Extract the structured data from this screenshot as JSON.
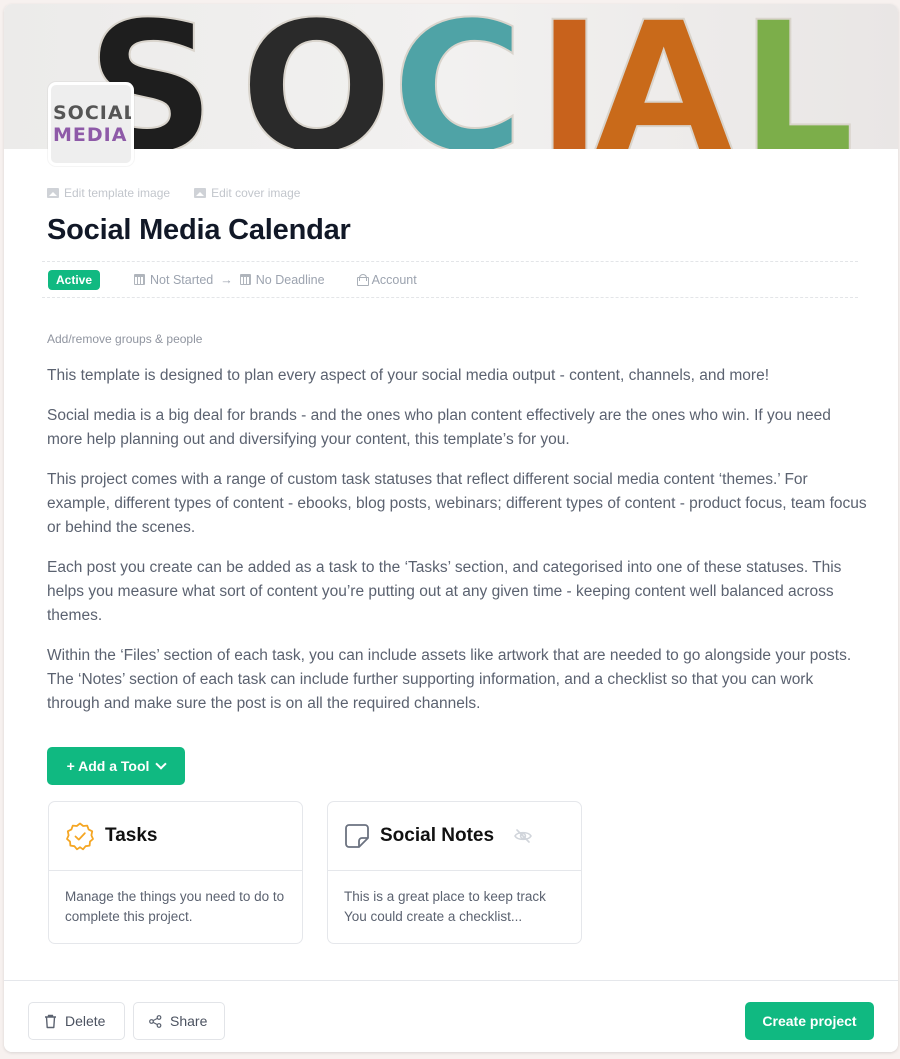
{
  "cover": {
    "letters": [
      "S",
      "O",
      "C",
      "I",
      "A",
      "L"
    ],
    "thumbnail_lines": [
      "SOCIAL",
      "MEDIA"
    ]
  },
  "edit_links": {
    "template_image": "Edit template image",
    "cover_image": "Edit cover image"
  },
  "project": {
    "title": "Social Media Calendar",
    "status": "Active",
    "start_date": "Not Started",
    "deadline": "No Deadline",
    "access": "Account",
    "arrow": "→",
    "groups_link": "Add/remove groups & people"
  },
  "description": [
    "This template is designed to plan every aspect of your social media output - content, channels, and more!",
    "Social media is a big deal for brands - and the ones who plan content effectively are the ones who win. If you need more help planning out and diversifying your content, this template’s for you.",
    "This project comes with a range of custom task statuses that reflect different social media content ‘themes.’ For example, different types of content - ebooks, blog posts, webinars; different types of content - product focus, team focus or behind the scenes.",
    "Each post you create can be added as a task to the ‘Tasks’ section, and categorised into one of these statuses. This helps you measure what sort of content you’re putting out at any given time - keeping content well balanced across themes.",
    "Within the ‘Files’ section of each task, you can include assets like artwork that are needed to go alongside your posts. The ‘Notes’ section of each task can include further supporting information, and a checklist so that you can work through and make sure the post is on all the required channels."
  ],
  "add_tool": {
    "label": "+ Add a Tool"
  },
  "tools": [
    {
      "name": "Tasks",
      "icon": "badge-check-icon",
      "description": "Manage the things you need to do to complete this project."
    },
    {
      "name": "Social Notes",
      "icon": "sticky-note-icon",
      "hidden": true,
      "description": "This is a great place to keep track You could create a checklist..."
    }
  ],
  "footer": {
    "delete_label": "Delete",
    "share_label": "Share",
    "create_label": "Create project"
  },
  "colors": {
    "accent": "#10b981",
    "tasks_icon": "#f5a623"
  }
}
